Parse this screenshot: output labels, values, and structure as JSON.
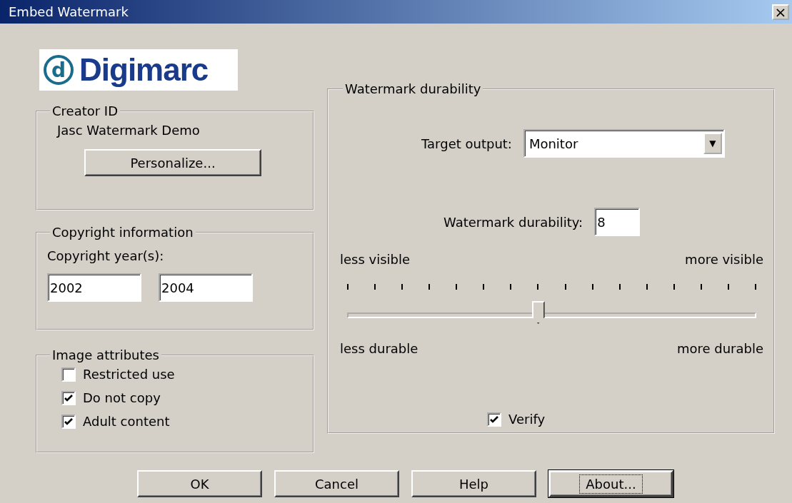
{
  "window": {
    "title": "Embed Watermark",
    "close": "×"
  },
  "logo": {
    "mark": "d",
    "name": "Digimarc"
  },
  "creator_id": {
    "title": "Creator ID",
    "name": "Jasc Watermark Demo",
    "button": {
      "label": "Personalize..."
    }
  },
  "copyright": {
    "title": "Copyright information",
    "label": "Copyright year(s):",
    "fields": [
      {
        "value": "2002"
      },
      {
        "value": "2004"
      }
    ]
  },
  "image_attributes": {
    "title": "Image attributes",
    "items": [
      {
        "label": "Restricted use",
        "checked": false
      },
      {
        "label": "Do not copy",
        "checked": true
      },
      {
        "label": "Adult content",
        "checked": true
      }
    ]
  },
  "durability": {
    "title": "Watermark durability",
    "target": {
      "label": "Target output:",
      "value": "Monitor",
      "arrow": "▼"
    },
    "value_field": {
      "label": "Watermark durability:",
      "value": "8"
    },
    "slider": {
      "level": 0.467,
      "top_left": "less visible",
      "top_right": "more visible",
      "bottom_left": "less durable",
      "bottom_right": "more durable"
    },
    "verify": {
      "label": "Verify",
      "checked": true
    }
  },
  "buttons": [
    {
      "label": "OK",
      "focused": false
    },
    {
      "label": "Cancel",
      "focused": false
    },
    {
      "label": "Help",
      "focused": false
    },
    {
      "label": "About...",
      "focused": true
    }
  ]
}
